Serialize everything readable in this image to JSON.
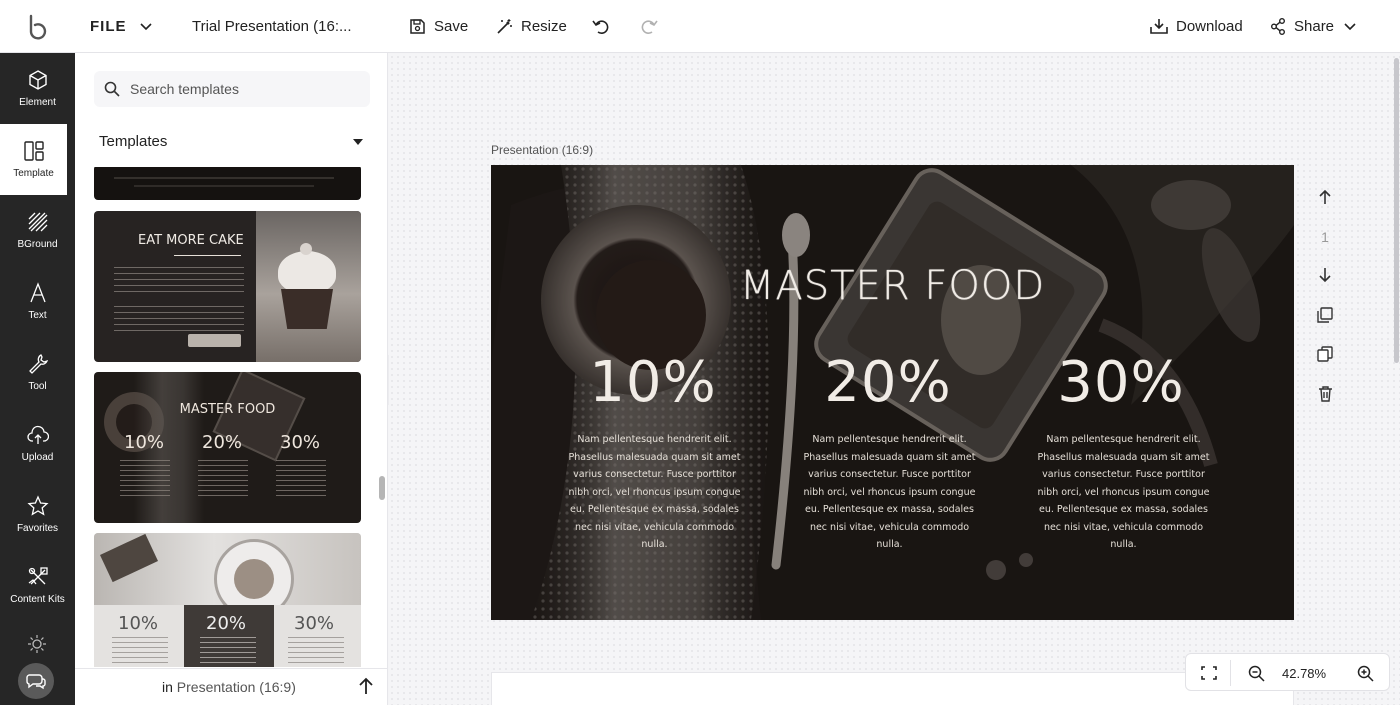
{
  "app": {
    "logo_icon": "b-logo-icon",
    "file_label": "FILE",
    "doc_title": "Trial Presentation (16:...",
    "save_label": "Save",
    "resize_label": "Resize",
    "download_label": "Download",
    "share_label": "Share"
  },
  "rail": {
    "items": [
      {
        "label": "Element",
        "icon": "cube-icon"
      },
      {
        "label": "Template",
        "icon": "template-icon"
      },
      {
        "label": "BGround",
        "icon": "hatch-icon"
      },
      {
        "label": "Text",
        "icon": "text-a-icon"
      },
      {
        "label": "Tool",
        "icon": "wrench-icon"
      },
      {
        "label": "Upload",
        "icon": "cloud-upload-icon"
      },
      {
        "label": "Favorites",
        "icon": "star-icon"
      },
      {
        "label": "Content Kits",
        "icon": "kits-icon"
      }
    ],
    "active": "Template"
  },
  "panel": {
    "search_placeholder": "Search templates",
    "heading": "Templates",
    "thumb_cake": {
      "title": "EAT MORE CAKE"
    },
    "thumb_food": {
      "title": "MASTER FOOD",
      "pcts": [
        "10%",
        "20%",
        "30%"
      ]
    },
    "thumb_coffee": {
      "pcts": [
        "10%",
        "20%",
        "30%"
      ]
    },
    "footer_in": "in",
    "footer_scope": "Presentation (16:9)"
  },
  "canvas": {
    "slide_label": "Presentation (16:9)",
    "slide": {
      "title": "MASTER FOOD",
      "columns": [
        {
          "pct": "10%",
          "body": "Nam pellentesque hendrerit elit. Phasellus malesuada quam sit amet varius consectetur. Fusce porttitor nibh orci, vel rhoncus ipsum congue eu. Pellentesque ex massa, sodales nec nisi vitae, vehicula commodo nulla."
        },
        {
          "pct": "20%",
          "body": "Nam pellentesque hendrerit elit. Phasellus malesuada quam sit amet varius consectetur. Fusce porttitor nibh orci, vel rhoncus ipsum congue eu. Pellentesque ex massa, sodales nec nisi vitae, vehicula commodo nulla."
        },
        {
          "pct": "30%",
          "body": "Nam pellentesque hendrerit elit. Phasellus malesuada quam sit amet varius consectetur. Fusce porttitor nibh orci, vel rhoncus ipsum congue eu. Pellentesque ex massa, sodales nec nisi vitae, vehicula commodo nulla."
        }
      ]
    },
    "page_number": "1",
    "zoom": "42.78%"
  }
}
